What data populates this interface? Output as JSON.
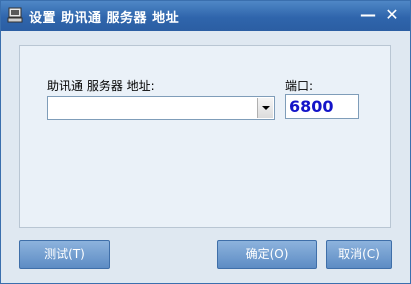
{
  "window": {
    "title": "设置 助讯通 服务器 地址",
    "minimize_glyph": "—",
    "close_glyph": "✕",
    "app_icon": "server-app-icon"
  },
  "form": {
    "server_label": "助讯通  服务器  地址:",
    "server_value": "",
    "port_label": "端口:",
    "port_value": "6800"
  },
  "buttons": {
    "test": "测试(T)",
    "ok": "确定(O)",
    "cancel": "取消(C)"
  },
  "colors": {
    "titlebar": "#2f65ac",
    "background": "#dfe8f1",
    "button": "#6a97cd",
    "port_text": "#1414c8"
  }
}
